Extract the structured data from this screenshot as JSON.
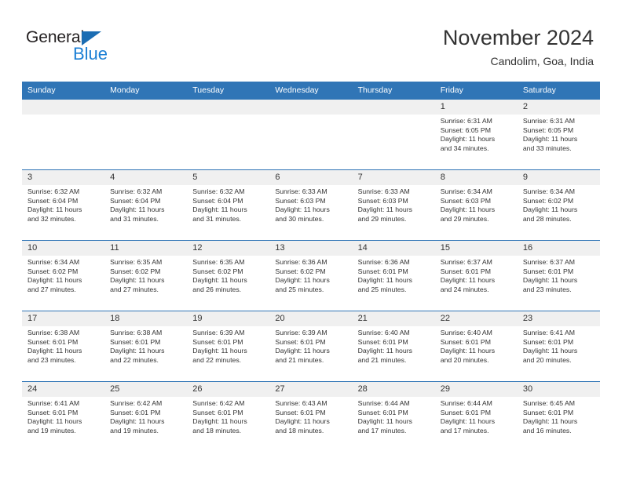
{
  "brand": {
    "name_part1": "General",
    "name_part2": "Blue",
    "triangle_color": "#1b6db3",
    "blue_text_color": "#1b7fd4"
  },
  "header": {
    "title": "November 2024",
    "subtitle": "Candolim, Goa, India",
    "accent_color": "#3075b6",
    "daynum_band_color": "#f0f0f0",
    "text_color": "#333333"
  },
  "weekday_headers": [
    "Sunday",
    "Monday",
    "Tuesday",
    "Wednesday",
    "Thursday",
    "Friday",
    "Saturday"
  ],
  "weeks": [
    [
      {
        "day": "",
        "empty": true,
        "lines": []
      },
      {
        "day": "",
        "empty": true,
        "lines": []
      },
      {
        "day": "",
        "empty": true,
        "lines": []
      },
      {
        "day": "",
        "empty": true,
        "lines": []
      },
      {
        "day": "",
        "empty": true,
        "lines": []
      },
      {
        "day": "1",
        "empty": false,
        "lines": [
          "Sunrise: 6:31 AM",
          "Sunset: 6:05 PM",
          "Daylight: 11 hours",
          "and 34 minutes."
        ]
      },
      {
        "day": "2",
        "empty": false,
        "lines": [
          "Sunrise: 6:31 AM",
          "Sunset: 6:05 PM",
          "Daylight: 11 hours",
          "and 33 minutes."
        ]
      }
    ],
    [
      {
        "day": "3",
        "empty": false,
        "lines": [
          "Sunrise: 6:32 AM",
          "Sunset: 6:04 PM",
          "Daylight: 11 hours",
          "and 32 minutes."
        ]
      },
      {
        "day": "4",
        "empty": false,
        "lines": [
          "Sunrise: 6:32 AM",
          "Sunset: 6:04 PM",
          "Daylight: 11 hours",
          "and 31 minutes."
        ]
      },
      {
        "day": "5",
        "empty": false,
        "lines": [
          "Sunrise: 6:32 AM",
          "Sunset: 6:04 PM",
          "Daylight: 11 hours",
          "and 31 minutes."
        ]
      },
      {
        "day": "6",
        "empty": false,
        "lines": [
          "Sunrise: 6:33 AM",
          "Sunset: 6:03 PM",
          "Daylight: 11 hours",
          "and 30 minutes."
        ]
      },
      {
        "day": "7",
        "empty": false,
        "lines": [
          "Sunrise: 6:33 AM",
          "Sunset: 6:03 PM",
          "Daylight: 11 hours",
          "and 29 minutes."
        ]
      },
      {
        "day": "8",
        "empty": false,
        "lines": [
          "Sunrise: 6:34 AM",
          "Sunset: 6:03 PM",
          "Daylight: 11 hours",
          "and 29 minutes."
        ]
      },
      {
        "day": "9",
        "empty": false,
        "lines": [
          "Sunrise: 6:34 AM",
          "Sunset: 6:02 PM",
          "Daylight: 11 hours",
          "and 28 minutes."
        ]
      }
    ],
    [
      {
        "day": "10",
        "empty": false,
        "lines": [
          "Sunrise: 6:34 AM",
          "Sunset: 6:02 PM",
          "Daylight: 11 hours",
          "and 27 minutes."
        ]
      },
      {
        "day": "11",
        "empty": false,
        "lines": [
          "Sunrise: 6:35 AM",
          "Sunset: 6:02 PM",
          "Daylight: 11 hours",
          "and 27 minutes."
        ]
      },
      {
        "day": "12",
        "empty": false,
        "lines": [
          "Sunrise: 6:35 AM",
          "Sunset: 6:02 PM",
          "Daylight: 11 hours",
          "and 26 minutes."
        ]
      },
      {
        "day": "13",
        "empty": false,
        "lines": [
          "Sunrise: 6:36 AM",
          "Sunset: 6:02 PM",
          "Daylight: 11 hours",
          "and 25 minutes."
        ]
      },
      {
        "day": "14",
        "empty": false,
        "lines": [
          "Sunrise: 6:36 AM",
          "Sunset: 6:01 PM",
          "Daylight: 11 hours",
          "and 25 minutes."
        ]
      },
      {
        "day": "15",
        "empty": false,
        "lines": [
          "Sunrise: 6:37 AM",
          "Sunset: 6:01 PM",
          "Daylight: 11 hours",
          "and 24 minutes."
        ]
      },
      {
        "day": "16",
        "empty": false,
        "lines": [
          "Sunrise: 6:37 AM",
          "Sunset: 6:01 PM",
          "Daylight: 11 hours",
          "and 23 minutes."
        ]
      }
    ],
    [
      {
        "day": "17",
        "empty": false,
        "lines": [
          "Sunrise: 6:38 AM",
          "Sunset: 6:01 PM",
          "Daylight: 11 hours",
          "and 23 minutes."
        ]
      },
      {
        "day": "18",
        "empty": false,
        "lines": [
          "Sunrise: 6:38 AM",
          "Sunset: 6:01 PM",
          "Daylight: 11 hours",
          "and 22 minutes."
        ]
      },
      {
        "day": "19",
        "empty": false,
        "lines": [
          "Sunrise: 6:39 AM",
          "Sunset: 6:01 PM",
          "Daylight: 11 hours",
          "and 22 minutes."
        ]
      },
      {
        "day": "20",
        "empty": false,
        "lines": [
          "Sunrise: 6:39 AM",
          "Sunset: 6:01 PM",
          "Daylight: 11 hours",
          "and 21 minutes."
        ]
      },
      {
        "day": "21",
        "empty": false,
        "lines": [
          "Sunrise: 6:40 AM",
          "Sunset: 6:01 PM",
          "Daylight: 11 hours",
          "and 21 minutes."
        ]
      },
      {
        "day": "22",
        "empty": false,
        "lines": [
          "Sunrise: 6:40 AM",
          "Sunset: 6:01 PM",
          "Daylight: 11 hours",
          "and 20 minutes."
        ]
      },
      {
        "day": "23",
        "empty": false,
        "lines": [
          "Sunrise: 6:41 AM",
          "Sunset: 6:01 PM",
          "Daylight: 11 hours",
          "and 20 minutes."
        ]
      }
    ],
    [
      {
        "day": "24",
        "empty": false,
        "lines": [
          "Sunrise: 6:41 AM",
          "Sunset: 6:01 PM",
          "Daylight: 11 hours",
          "and 19 minutes."
        ]
      },
      {
        "day": "25",
        "empty": false,
        "lines": [
          "Sunrise: 6:42 AM",
          "Sunset: 6:01 PM",
          "Daylight: 11 hours",
          "and 19 minutes."
        ]
      },
      {
        "day": "26",
        "empty": false,
        "lines": [
          "Sunrise: 6:42 AM",
          "Sunset: 6:01 PM",
          "Daylight: 11 hours",
          "and 18 minutes."
        ]
      },
      {
        "day": "27",
        "empty": false,
        "lines": [
          "Sunrise: 6:43 AM",
          "Sunset: 6:01 PM",
          "Daylight: 11 hours",
          "and 18 minutes."
        ]
      },
      {
        "day": "28",
        "empty": false,
        "lines": [
          "Sunrise: 6:44 AM",
          "Sunset: 6:01 PM",
          "Daylight: 11 hours",
          "and 17 minutes."
        ]
      },
      {
        "day": "29",
        "empty": false,
        "lines": [
          "Sunrise: 6:44 AM",
          "Sunset: 6:01 PM",
          "Daylight: 11 hours",
          "and 17 minutes."
        ]
      },
      {
        "day": "30",
        "empty": false,
        "lines": [
          "Sunrise: 6:45 AM",
          "Sunset: 6:01 PM",
          "Daylight: 11 hours",
          "and 16 minutes."
        ]
      }
    ]
  ]
}
